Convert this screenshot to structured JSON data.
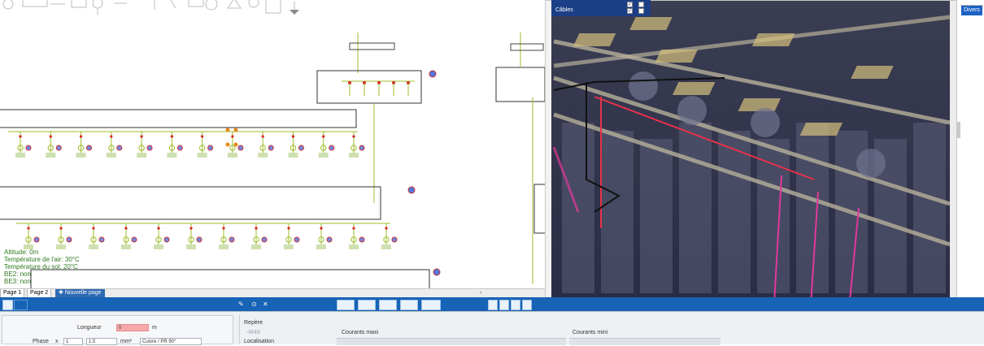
{
  "schematic": {
    "annotations": [
      "Altitude: 0m",
      "Température de l'air: 30°C",
      "Température du sol: 20°C",
      "BE2: non",
      "BE3: non"
    ]
  },
  "pages": {
    "tabs": [
      "Page 1",
      "Page 2"
    ],
    "new_page": "Nouvelle page"
  },
  "layers": {
    "cables_label": "Câbles"
  },
  "right_panel": {
    "selected": "Divers"
  },
  "properties": {
    "longueur_label": "Longueur",
    "longueur_value": "0",
    "longueur_unit": "m",
    "phase_label": "Phase",
    "phase_count": "1",
    "section": "1.5",
    "section_unit": "mm²",
    "material": "Cuivre / PR 90°",
    "repere_label": "Repère",
    "repere_value": "-W49",
    "localisation_label": "Localisation",
    "courants_maxi": "Courants maxi",
    "courants_mini": "Courants mini"
  },
  "colors": {
    "toolbar_blue": "#1763b5",
    "wire_green": "#9fbd2a",
    "scene_dark": "#2c2c4a",
    "cable_red": "#e8314a",
    "tray_tan": "#d6c07c"
  }
}
